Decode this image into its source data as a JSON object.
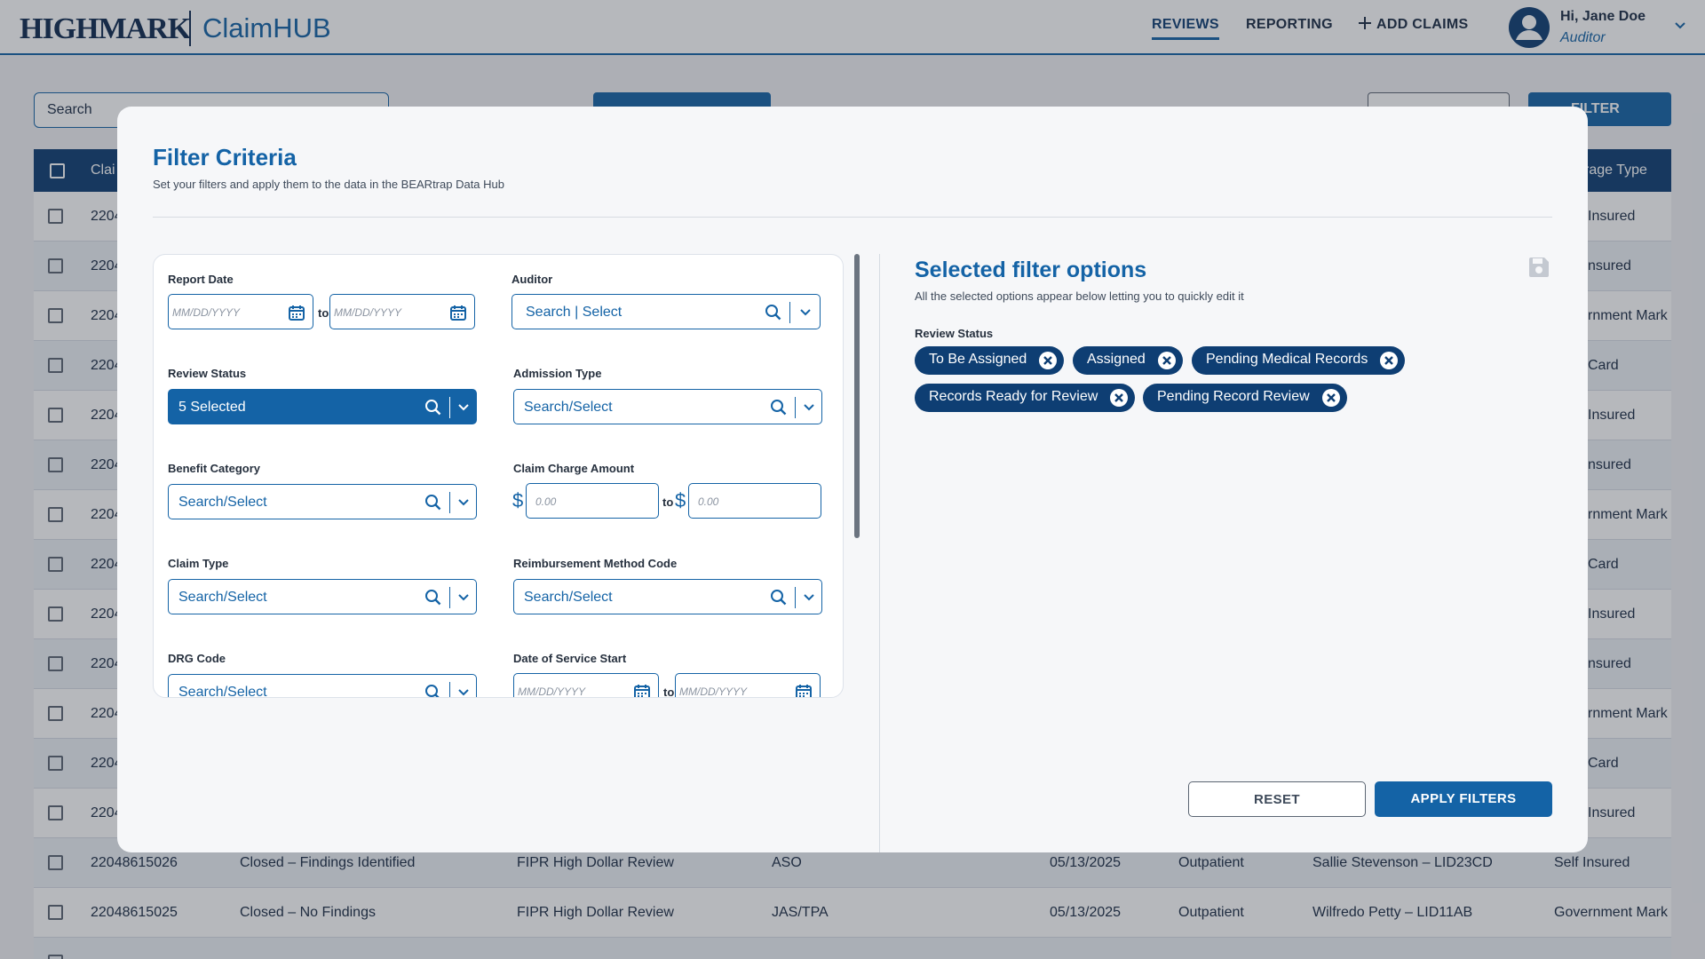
{
  "header": {
    "logo": "HIGHMARK",
    "app_name": "ClaimHUB",
    "nav": {
      "reviews": "REVIEWS",
      "reporting": "REPORTING",
      "add_claims": "ADD CLAIMS"
    },
    "user": {
      "greeting": "Hi, Jane Doe",
      "role": "Auditor"
    }
  },
  "background": {
    "search_placeholder": "Search",
    "filter_label": "FILTER",
    "table": {
      "header_first": "Clai",
      "header_last": "rage Type",
      "rows": [
        {
          "id": "2204",
          "col_last": "Insured"
        },
        {
          "id": "2204",
          "col_last": "nsured"
        },
        {
          "id": "2204",
          "col_last": "rnment Mark"
        },
        {
          "id": "2204",
          "col_last": "Card"
        },
        {
          "id": "2204",
          "col_last": "Insured"
        },
        {
          "id": "2204",
          "col_last": "nsured"
        },
        {
          "id": "2204",
          "col_last": "rnment Mark"
        },
        {
          "id": "2204",
          "col_last": "Card"
        },
        {
          "id": "2204",
          "col_last": "Insured"
        },
        {
          "id": "2204",
          "col_last": "nsured"
        },
        {
          "id": "2204",
          "col_last": "rnment Mark"
        },
        {
          "id": "2204",
          "col_last": "Card"
        },
        {
          "id": "2204",
          "col_last": "Insured"
        }
      ],
      "full_rows": [
        {
          "id": "22048615026",
          "status": "Closed – Findings Identified",
          "review": "FIPR High Dollar Review",
          "funding": "ASO",
          "date": "05/13/2025",
          "setting": "Outpatient",
          "assignee": "Sallie Stevenson – LID23CD",
          "coverage": "Self Insured"
        },
        {
          "id": "22048615025",
          "status": "Closed – No Findings",
          "review": "FIPR High Dollar Review",
          "funding": "JAS/TPA",
          "date": "05/13/2025",
          "setting": "Outpatient",
          "assignee": "Wilfredo Petty – LID11AB",
          "coverage": "Government Mark"
        }
      ]
    }
  },
  "modal": {
    "title": "Filter Criteria",
    "subtitle": "Set your filters and apply them to the data in the BEARtrap Data Hub",
    "fields": {
      "report_date": {
        "label": "Report Date",
        "from_placeholder": "MM/DD/YYYY",
        "to_placeholder": "MM/DD/YYYY",
        "to_text": "to"
      },
      "auditor": {
        "label": "Auditor",
        "placeholder": "Search | Select"
      },
      "review_status": {
        "label": "Review Status",
        "value": "5 Selected"
      },
      "admission_type": {
        "label": "Admission Type",
        "placeholder": "Search/Select"
      },
      "benefit_category": {
        "label": "Benefit Category",
        "placeholder": "Search/Select"
      },
      "claim_charge_amount": {
        "label": "Claim Charge Amount",
        "currency": "$",
        "from_placeholder": "0.00",
        "to_placeholder": "0.00",
        "to_text": "to"
      },
      "claim_type": {
        "label": "Claim Type",
        "placeholder": "Search/Select"
      },
      "reimbursement_method_code": {
        "label": "Reimbursement Method Code",
        "placeholder": "Search/Select"
      },
      "drg_code": {
        "label": "DRG Code",
        "placeholder": "Search/Select"
      },
      "date_of_service_start": {
        "label": "Date of Service Start",
        "from_placeholder": "MM/DD/YYYY",
        "to_placeholder": "MM/DD/YYYY",
        "to_text": "to"
      }
    },
    "selected": {
      "title": "Selected filter options",
      "subtitle": "All the selected options appear below letting you to quickly edit it",
      "group_label": "Review Status",
      "chips": [
        "To Be Assigned",
        "Assigned",
        "Pending Medical Records",
        "Records Ready for Review",
        "Pending Record Review"
      ]
    },
    "buttons": {
      "reset": "RESET",
      "apply": "APPLY FILTERS"
    }
  },
  "colors": {
    "brand": "#1463a6",
    "navy": "#0e3e73"
  }
}
